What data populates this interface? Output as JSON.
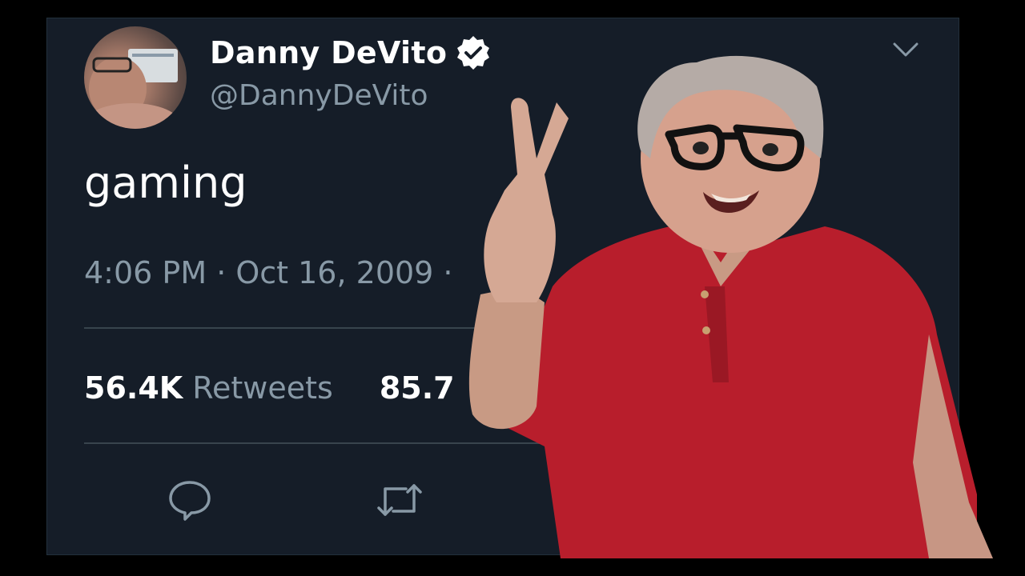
{
  "tweet": {
    "display_name": "Danny DeVito",
    "handle": "@DannyDeVito",
    "text": "gaming",
    "timestamp": "4:06 PM · Oct 16, 2009 · ",
    "retweets_count": "56.4K",
    "retweets_label": "Retweets",
    "likes_count_partial": "85.7"
  },
  "icons": {
    "verified": "verified-badge-icon",
    "caret": "chevron-down-icon",
    "reply": "reply-icon",
    "retweet": "retweet-icon"
  },
  "colors": {
    "background": "#151d28",
    "primary_text": "#ffffff",
    "secondary_text": "#8899a6",
    "divider": "#38444d",
    "shirt": "#b81e2c"
  }
}
